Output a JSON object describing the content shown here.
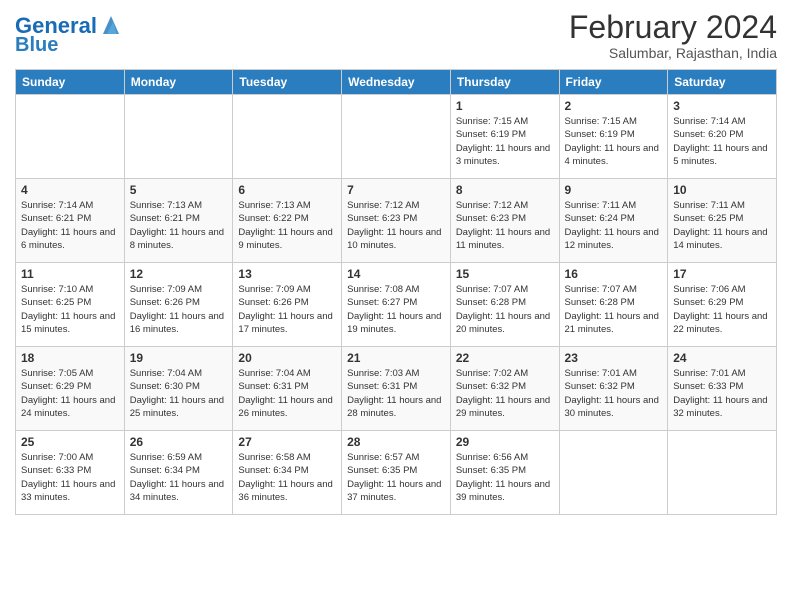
{
  "header": {
    "logo_line1": "General",
    "logo_line2": "Blue",
    "month_title": "February 2024",
    "location": "Salumbar, Rajasthan, India"
  },
  "weekdays": [
    "Sunday",
    "Monday",
    "Tuesday",
    "Wednesday",
    "Thursday",
    "Friday",
    "Saturday"
  ],
  "weeks": [
    [
      {
        "day": "",
        "info": ""
      },
      {
        "day": "",
        "info": ""
      },
      {
        "day": "",
        "info": ""
      },
      {
        "day": "",
        "info": ""
      },
      {
        "day": "1",
        "info": "Sunrise: 7:15 AM\nSunset: 6:19 PM\nDaylight: 11 hours\nand 3 minutes."
      },
      {
        "day": "2",
        "info": "Sunrise: 7:15 AM\nSunset: 6:19 PM\nDaylight: 11 hours\nand 4 minutes."
      },
      {
        "day": "3",
        "info": "Sunrise: 7:14 AM\nSunset: 6:20 PM\nDaylight: 11 hours\nand 5 minutes."
      }
    ],
    [
      {
        "day": "4",
        "info": "Sunrise: 7:14 AM\nSunset: 6:21 PM\nDaylight: 11 hours\nand 6 minutes."
      },
      {
        "day": "5",
        "info": "Sunrise: 7:13 AM\nSunset: 6:21 PM\nDaylight: 11 hours\nand 8 minutes."
      },
      {
        "day": "6",
        "info": "Sunrise: 7:13 AM\nSunset: 6:22 PM\nDaylight: 11 hours\nand 9 minutes."
      },
      {
        "day": "7",
        "info": "Sunrise: 7:12 AM\nSunset: 6:23 PM\nDaylight: 11 hours\nand 10 minutes."
      },
      {
        "day": "8",
        "info": "Sunrise: 7:12 AM\nSunset: 6:23 PM\nDaylight: 11 hours\nand 11 minutes."
      },
      {
        "day": "9",
        "info": "Sunrise: 7:11 AM\nSunset: 6:24 PM\nDaylight: 11 hours\nand 12 minutes."
      },
      {
        "day": "10",
        "info": "Sunrise: 7:11 AM\nSunset: 6:25 PM\nDaylight: 11 hours\nand 14 minutes."
      }
    ],
    [
      {
        "day": "11",
        "info": "Sunrise: 7:10 AM\nSunset: 6:25 PM\nDaylight: 11 hours\nand 15 minutes."
      },
      {
        "day": "12",
        "info": "Sunrise: 7:09 AM\nSunset: 6:26 PM\nDaylight: 11 hours\nand 16 minutes."
      },
      {
        "day": "13",
        "info": "Sunrise: 7:09 AM\nSunset: 6:26 PM\nDaylight: 11 hours\nand 17 minutes."
      },
      {
        "day": "14",
        "info": "Sunrise: 7:08 AM\nSunset: 6:27 PM\nDaylight: 11 hours\nand 19 minutes."
      },
      {
        "day": "15",
        "info": "Sunrise: 7:07 AM\nSunset: 6:28 PM\nDaylight: 11 hours\nand 20 minutes."
      },
      {
        "day": "16",
        "info": "Sunrise: 7:07 AM\nSunset: 6:28 PM\nDaylight: 11 hours\nand 21 minutes."
      },
      {
        "day": "17",
        "info": "Sunrise: 7:06 AM\nSunset: 6:29 PM\nDaylight: 11 hours\nand 22 minutes."
      }
    ],
    [
      {
        "day": "18",
        "info": "Sunrise: 7:05 AM\nSunset: 6:29 PM\nDaylight: 11 hours\nand 24 minutes."
      },
      {
        "day": "19",
        "info": "Sunrise: 7:04 AM\nSunset: 6:30 PM\nDaylight: 11 hours\nand 25 minutes."
      },
      {
        "day": "20",
        "info": "Sunrise: 7:04 AM\nSunset: 6:31 PM\nDaylight: 11 hours\nand 26 minutes."
      },
      {
        "day": "21",
        "info": "Sunrise: 7:03 AM\nSunset: 6:31 PM\nDaylight: 11 hours\nand 28 minutes."
      },
      {
        "day": "22",
        "info": "Sunrise: 7:02 AM\nSunset: 6:32 PM\nDaylight: 11 hours\nand 29 minutes."
      },
      {
        "day": "23",
        "info": "Sunrise: 7:01 AM\nSunset: 6:32 PM\nDaylight: 11 hours\nand 30 minutes."
      },
      {
        "day": "24",
        "info": "Sunrise: 7:01 AM\nSunset: 6:33 PM\nDaylight: 11 hours\nand 32 minutes."
      }
    ],
    [
      {
        "day": "25",
        "info": "Sunrise: 7:00 AM\nSunset: 6:33 PM\nDaylight: 11 hours\nand 33 minutes."
      },
      {
        "day": "26",
        "info": "Sunrise: 6:59 AM\nSunset: 6:34 PM\nDaylight: 11 hours\nand 34 minutes."
      },
      {
        "day": "27",
        "info": "Sunrise: 6:58 AM\nSunset: 6:34 PM\nDaylight: 11 hours\nand 36 minutes."
      },
      {
        "day": "28",
        "info": "Sunrise: 6:57 AM\nSunset: 6:35 PM\nDaylight: 11 hours\nand 37 minutes."
      },
      {
        "day": "29",
        "info": "Sunrise: 6:56 AM\nSunset: 6:35 PM\nDaylight: 11 hours\nand 39 minutes."
      },
      {
        "day": "",
        "info": ""
      },
      {
        "day": "",
        "info": ""
      }
    ]
  ]
}
